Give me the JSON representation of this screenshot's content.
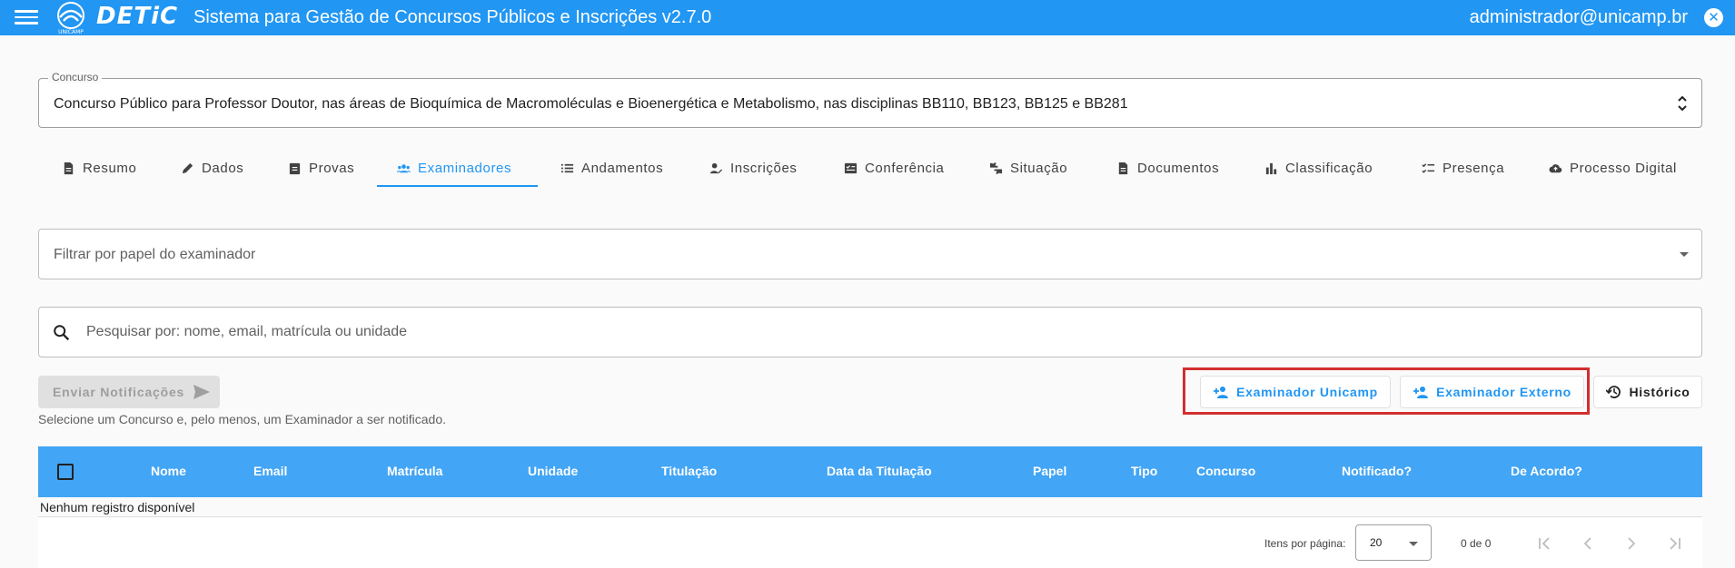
{
  "app": {
    "logo_text": "DETiC",
    "logo_sub": "UNICAMP",
    "title": "Sistema para Gestão de Concursos Públicos e Inscrições v2.7.0",
    "user_email": "administrador@unicamp.br",
    "close_glyph": "✕"
  },
  "concurso": {
    "label": "Concurso",
    "value": "Concurso Público para Professor Doutor, nas áreas de Bioquímica de Macromoléculas e Bioenergética e Metabolismo, nas disciplinas BB110, BB123, BB125 e BB281"
  },
  "tabs": [
    {
      "label": "Resumo",
      "icon": "document-icon"
    },
    {
      "label": "Dados",
      "icon": "pencil-icon"
    },
    {
      "label": "Provas",
      "icon": "clipboard-icon"
    },
    {
      "label": "Examinadores",
      "icon": "group-icon",
      "active": true
    },
    {
      "label": "Andamentos",
      "icon": "list-icon"
    },
    {
      "label": "Inscrições",
      "icon": "person-edit-icon"
    },
    {
      "label": "Conferência",
      "icon": "checklist-box-icon"
    },
    {
      "label": "Situação",
      "icon": "thumbs-icon"
    },
    {
      "label": "Documentos",
      "icon": "file-icon"
    },
    {
      "label": "Classificação",
      "icon": "bar-chart-icon"
    },
    {
      "label": "Presença",
      "icon": "checklist-icon"
    },
    {
      "label": "Processo Digital",
      "icon": "cloud-upload-icon"
    }
  ],
  "filter": {
    "placeholder": "Filtrar por papel do examinador"
  },
  "search": {
    "placeholder": "Pesquisar por: nome, email, matrícula ou unidade",
    "value": ""
  },
  "notify": {
    "button_label": "Enviar Notificações",
    "hint": "Selecione um Concurso e, pelo menos, um Examinador a ser notificado."
  },
  "actions": {
    "unicamp_label": "Examinador Unicamp",
    "externo_label": "Examinador Externo",
    "historico_label": "Histórico"
  },
  "table": {
    "columns": [
      "Nome",
      "Email",
      "Matrícula",
      "Unidade",
      "Titulação",
      "Data da Titulação",
      "Papel",
      "Tipo",
      "Concurso",
      "Notificado?",
      "De Acordo?"
    ],
    "empty_message": "Nenhum registro disponível"
  },
  "paginator": {
    "items_per_page_label": "Itens por página:",
    "page_size": "20",
    "range": "0 de 0"
  },
  "colors": {
    "primary": "#2196f3",
    "table_header": "#42a5f5",
    "highlight": "#d32f2f"
  }
}
